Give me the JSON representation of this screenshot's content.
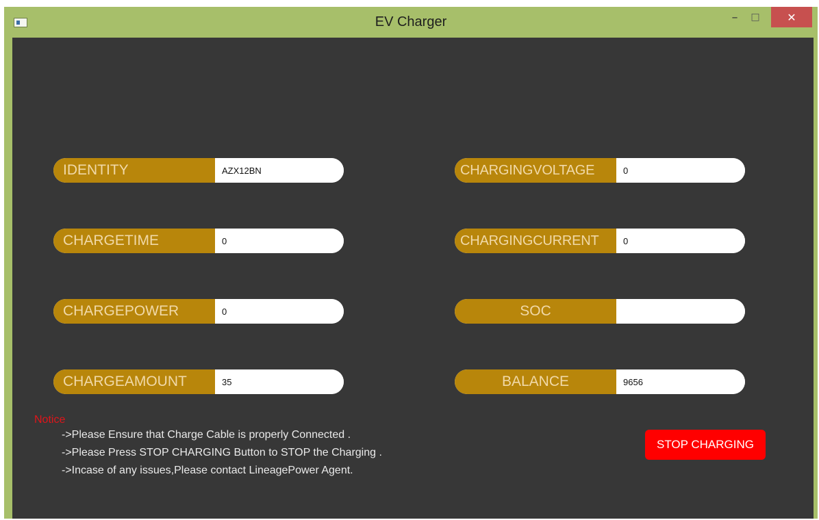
{
  "window": {
    "title": "EV Charger",
    "controls": {
      "minimize": "–",
      "maximize": "□",
      "close": "✕"
    }
  },
  "fields": {
    "identity": {
      "label": "IDENTITY",
      "value": "AZX12BN"
    },
    "chargetime": {
      "label": "CHARGETIME",
      "value": "0"
    },
    "chargepower": {
      "label": "CHARGEPOWER",
      "value": "0"
    },
    "chargeamount": {
      "label": "CHARGEAMOUNT",
      "value": "35"
    },
    "chargingvoltage": {
      "label": "CHARGINGVOLTAGE",
      "value": "0"
    },
    "chargingcurrent": {
      "label": "CHARGINGCURRENT",
      "value": "0"
    },
    "soc": {
      "label": "SOC",
      "value": ""
    },
    "balance": {
      "label": "BALANCE",
      "value": "9656"
    }
  },
  "notice": {
    "title": "Notice",
    "lines": [
      "->Please Ensure that Charge Cable is properly Connected .",
      "->Please Press STOP CHARGING Button to STOP the Charging .",
      "->Incase of any issues,Please contact LineagePower Agent."
    ]
  },
  "actions": {
    "stop_label": "STOP CHARGING"
  },
  "colors": {
    "frame": "#a7bf6a",
    "background": "#373737",
    "label_bg": "#b8860b",
    "label_text": "#f1d9a8",
    "notice": "#e0151a",
    "stop_button": "#ff0000",
    "close_button": "#c7504f"
  }
}
